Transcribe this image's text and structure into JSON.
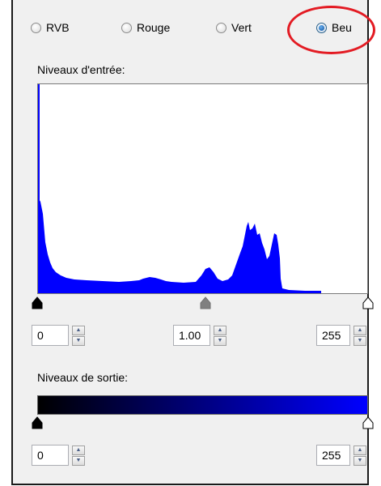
{
  "channels": {
    "items": [
      {
        "label": "RVB",
        "checked": false
      },
      {
        "label": "Rouge",
        "checked": false
      },
      {
        "label": "Vert",
        "checked": false
      },
      {
        "label": "Beu",
        "checked": true
      }
    ]
  },
  "input_levels": {
    "title": "Niveaux d'entrée:",
    "black_value": "0",
    "gamma_value": "1.00",
    "white_value": "255",
    "histogram_color": "#0000ff"
  },
  "output_levels": {
    "title": "Niveaux de sortie:",
    "black_value": "0",
    "white_value": "255",
    "gradient_start": "#000000",
    "gradient_end": "#0000ff"
  },
  "colors": {
    "annotation": "#e31b23",
    "panel_bg": "#f0f0f0"
  }
}
